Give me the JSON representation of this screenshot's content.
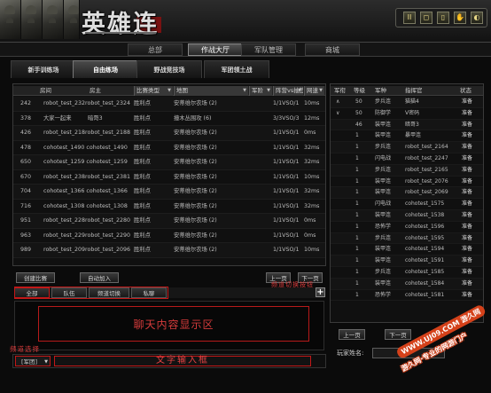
{
  "header": {
    "title": "英雄连",
    "tool_buttons": [
      "II",
      "◻",
      "▯",
      "✋",
      "◐"
    ]
  },
  "main_nav": {
    "tabs": [
      {
        "label": "总部",
        "active": false
      },
      {
        "label": "作战大厅",
        "active": true
      },
      {
        "label": "军队管理",
        "active": false
      },
      {
        "label": "商城",
        "active": false
      }
    ]
  },
  "sub_tabs": [
    {
      "label": "新手训练场",
      "active": false
    },
    {
      "label": "自由练场",
      "active": true
    },
    {
      "label": "野战竞技场",
      "active": false
    },
    {
      "label": "军团领土战",
      "active": false
    }
  ],
  "room_table": {
    "headers": [
      "房间",
      "房主",
      "比赛类型",
      "地图",
      "军阶",
      "阵营vs抽签",
      "网速"
    ],
    "rows": [
      [
        "242",
        "robot_test_232robot_test_2324",
        "胜利点",
        "安蒂维尔农场 (2)",
        "",
        "1/1VSO/1",
        "10ms"
      ],
      [
        "378",
        "大家一起来",
        "暗哥3",
        "胜利点",
        "撞木丛围攻 (6)",
        "",
        "3/3VSO/3",
        "12ms"
      ],
      [
        "426",
        "robot_test_218robot_test_2188",
        "胜利点",
        "安蒂维尔农场 (2)",
        "",
        "1/1VSO/1",
        "0ms"
      ],
      [
        "478",
        "cohotest_1490 cohotest_1490",
        "胜利点",
        "安蒂维尔农场 (2)",
        "",
        "1/1VSO/1",
        "32ms"
      ],
      [
        "650",
        "cohotest_1259 cohotest_1259",
        "胜利点",
        "安蒂维尔农场 (2)",
        "",
        "1/1VSO/1",
        "32ms"
      ],
      [
        "670",
        "robot_test_238robot_test_2381",
        "胜利点",
        "安蒂维尔农场 (2)",
        "",
        "1/1VSO/1",
        "10ms"
      ],
      [
        "704",
        "cohotest_1366 cohotest_1366",
        "胜利点",
        "安蒂维尔农场 (2)",
        "",
        "1/1VSO/1",
        "32ms"
      ],
      [
        "716",
        "cohotest_1308 cohotest_1308",
        "胜利点",
        "安蒂维尔农场 (2)",
        "",
        "1/1VSO/1",
        "32ms"
      ],
      [
        "951",
        "robot_test_228robot_test_2280",
        "胜利点",
        "安蒂维尔农场 (2)",
        "",
        "1/1VSO/1",
        "0ms"
      ],
      [
        "963",
        "robot_test_229robot_test_2290",
        "胜利点",
        "安蒂维尔农场 (2)",
        "",
        "1/1VSO/1",
        "0ms"
      ],
      [
        "989",
        "robot_test_209robot_test_2096",
        "胜利点",
        "安蒂维尔农场 (2)",
        "",
        "1/1VSO/1",
        "10ms"
      ]
    ],
    "create_button": "创建比赛",
    "auto_join_button": "自动加入",
    "prev_button": "上一页",
    "next_button": "下一页"
  },
  "chat": {
    "tabs": [
      "全部",
      "队伍",
      "频道切换",
      "私聊"
    ],
    "display_note": "聊天内容显示区",
    "channel_value": "[军团]",
    "input_note": "文字输入框",
    "channel_note": "频道选择",
    "switch_note": "频道切换按钮"
  },
  "player_table": {
    "headers": [
      "军衔",
      "等级",
      "军种",
      "指挥官",
      "状态"
    ],
    "rows": [
      [
        "∧",
        "50",
        "步兵连",
        "猫猫4",
        "准备"
      ],
      [
        "∨",
        "50",
        "防御学",
        "V密码",
        "准备"
      ],
      [
        "",
        "46",
        "装甲连",
        "暗哥3",
        "准备"
      ],
      [
        "",
        "1",
        "装甲连",
        "暴甲连",
        "准备"
      ],
      [
        "",
        "1",
        "步兵连",
        "robot_test_2164",
        "准备"
      ],
      [
        "",
        "1",
        "闪电战",
        "robot_test_2247",
        "准备"
      ],
      [
        "",
        "1",
        "步兵连",
        "robot_test_2165",
        "准备"
      ],
      [
        "",
        "1",
        "装甲连",
        "robot_test_2076",
        "准备"
      ],
      [
        "",
        "1",
        "装甲连",
        "robot_test_2069",
        "准备"
      ],
      [
        "",
        "1",
        "闪电战",
        "cohotest_1575",
        "准备"
      ],
      [
        "",
        "1",
        "装甲连",
        "cohotest_1538",
        "准备"
      ],
      [
        "",
        "1",
        "恐怖学",
        "cohotest_1596",
        "准备"
      ],
      [
        "",
        "1",
        "步兵连",
        "cohotest_1595",
        "准备"
      ],
      [
        "",
        "1",
        "装甲连",
        "cohotest_1594",
        "准备"
      ],
      [
        "",
        "1",
        "装甲连",
        "cohotest_1591",
        "准备"
      ],
      [
        "",
        "1",
        "步兵连",
        "cohotest_1585",
        "准备"
      ],
      [
        "",
        "1",
        "装甲连",
        "cohotest_1584",
        "准备"
      ],
      [
        "",
        "1",
        "恐怖学",
        "cohotest_1581",
        "准备"
      ]
    ],
    "prev_button": "上一页",
    "next_button": "下一页",
    "name_label": "玩家姓名:"
  },
  "watermark": {
    "line1": "WWW.UJ09.COM 游久网",
    "line2": "游久网·专业的网游门户"
  }
}
